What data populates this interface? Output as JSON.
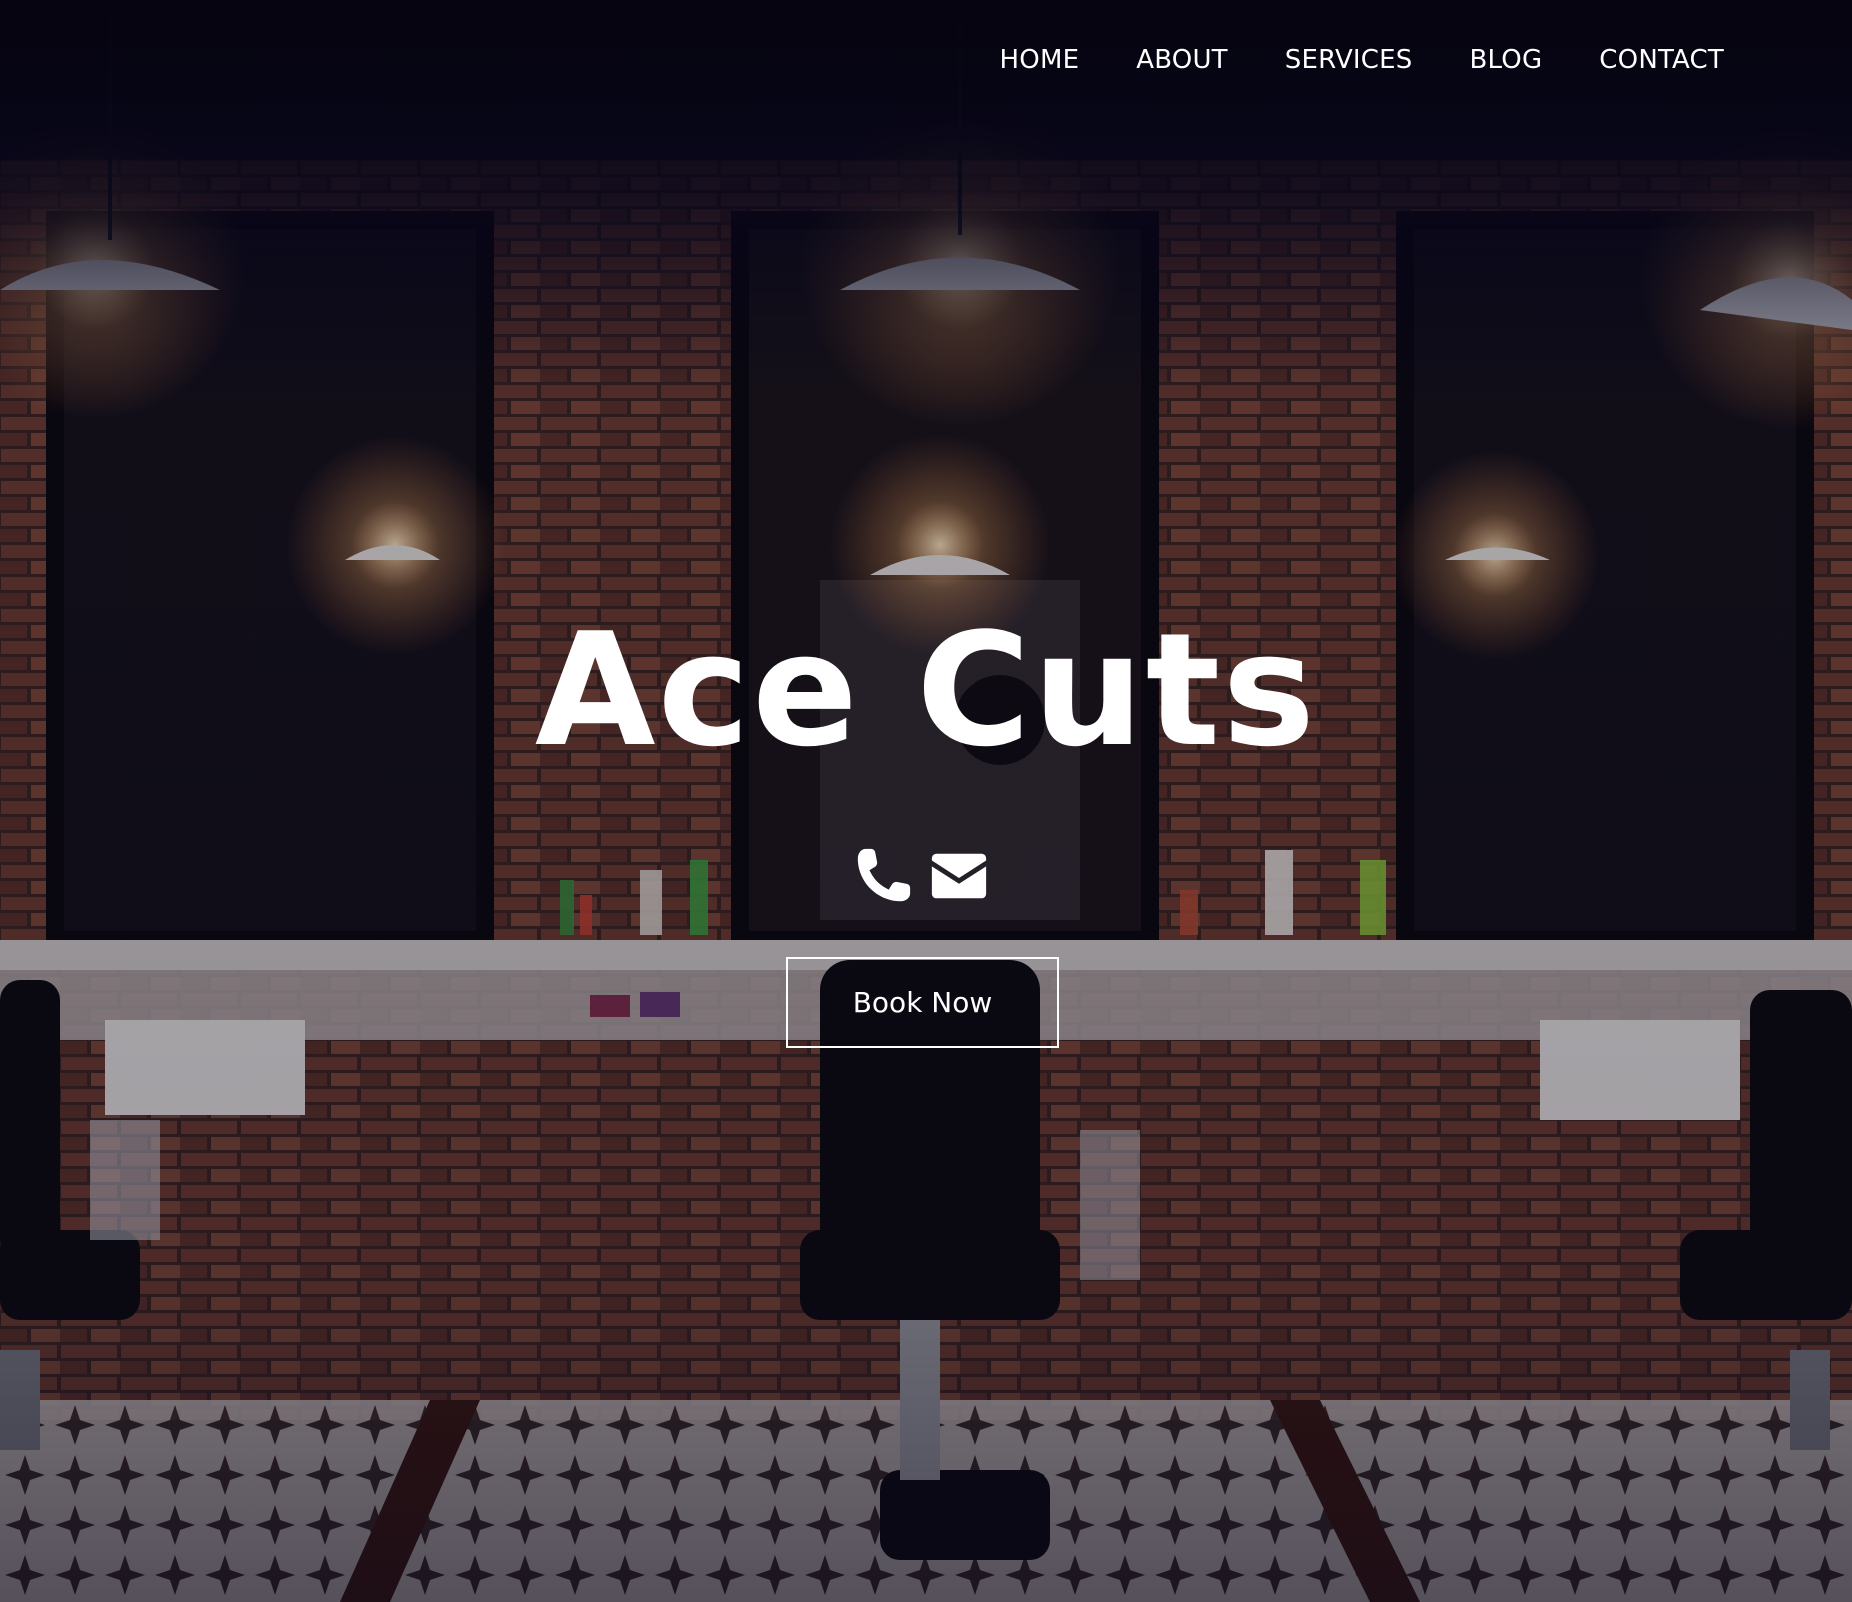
{
  "nav": {
    "items": [
      {
        "label": "HOME"
      },
      {
        "label": "ABOUT"
      },
      {
        "label": "SERVICES"
      },
      {
        "label": "BLOG"
      },
      {
        "label": "CONTACT"
      }
    ]
  },
  "hero": {
    "title": "Ace Cuts",
    "cta_label": "Book Now",
    "icons": [
      "phone-icon",
      "envelope-icon"
    ]
  },
  "colors": {
    "text": "#ffffff",
    "overlay": "#0a0818",
    "brick": "#6b3a2e"
  }
}
